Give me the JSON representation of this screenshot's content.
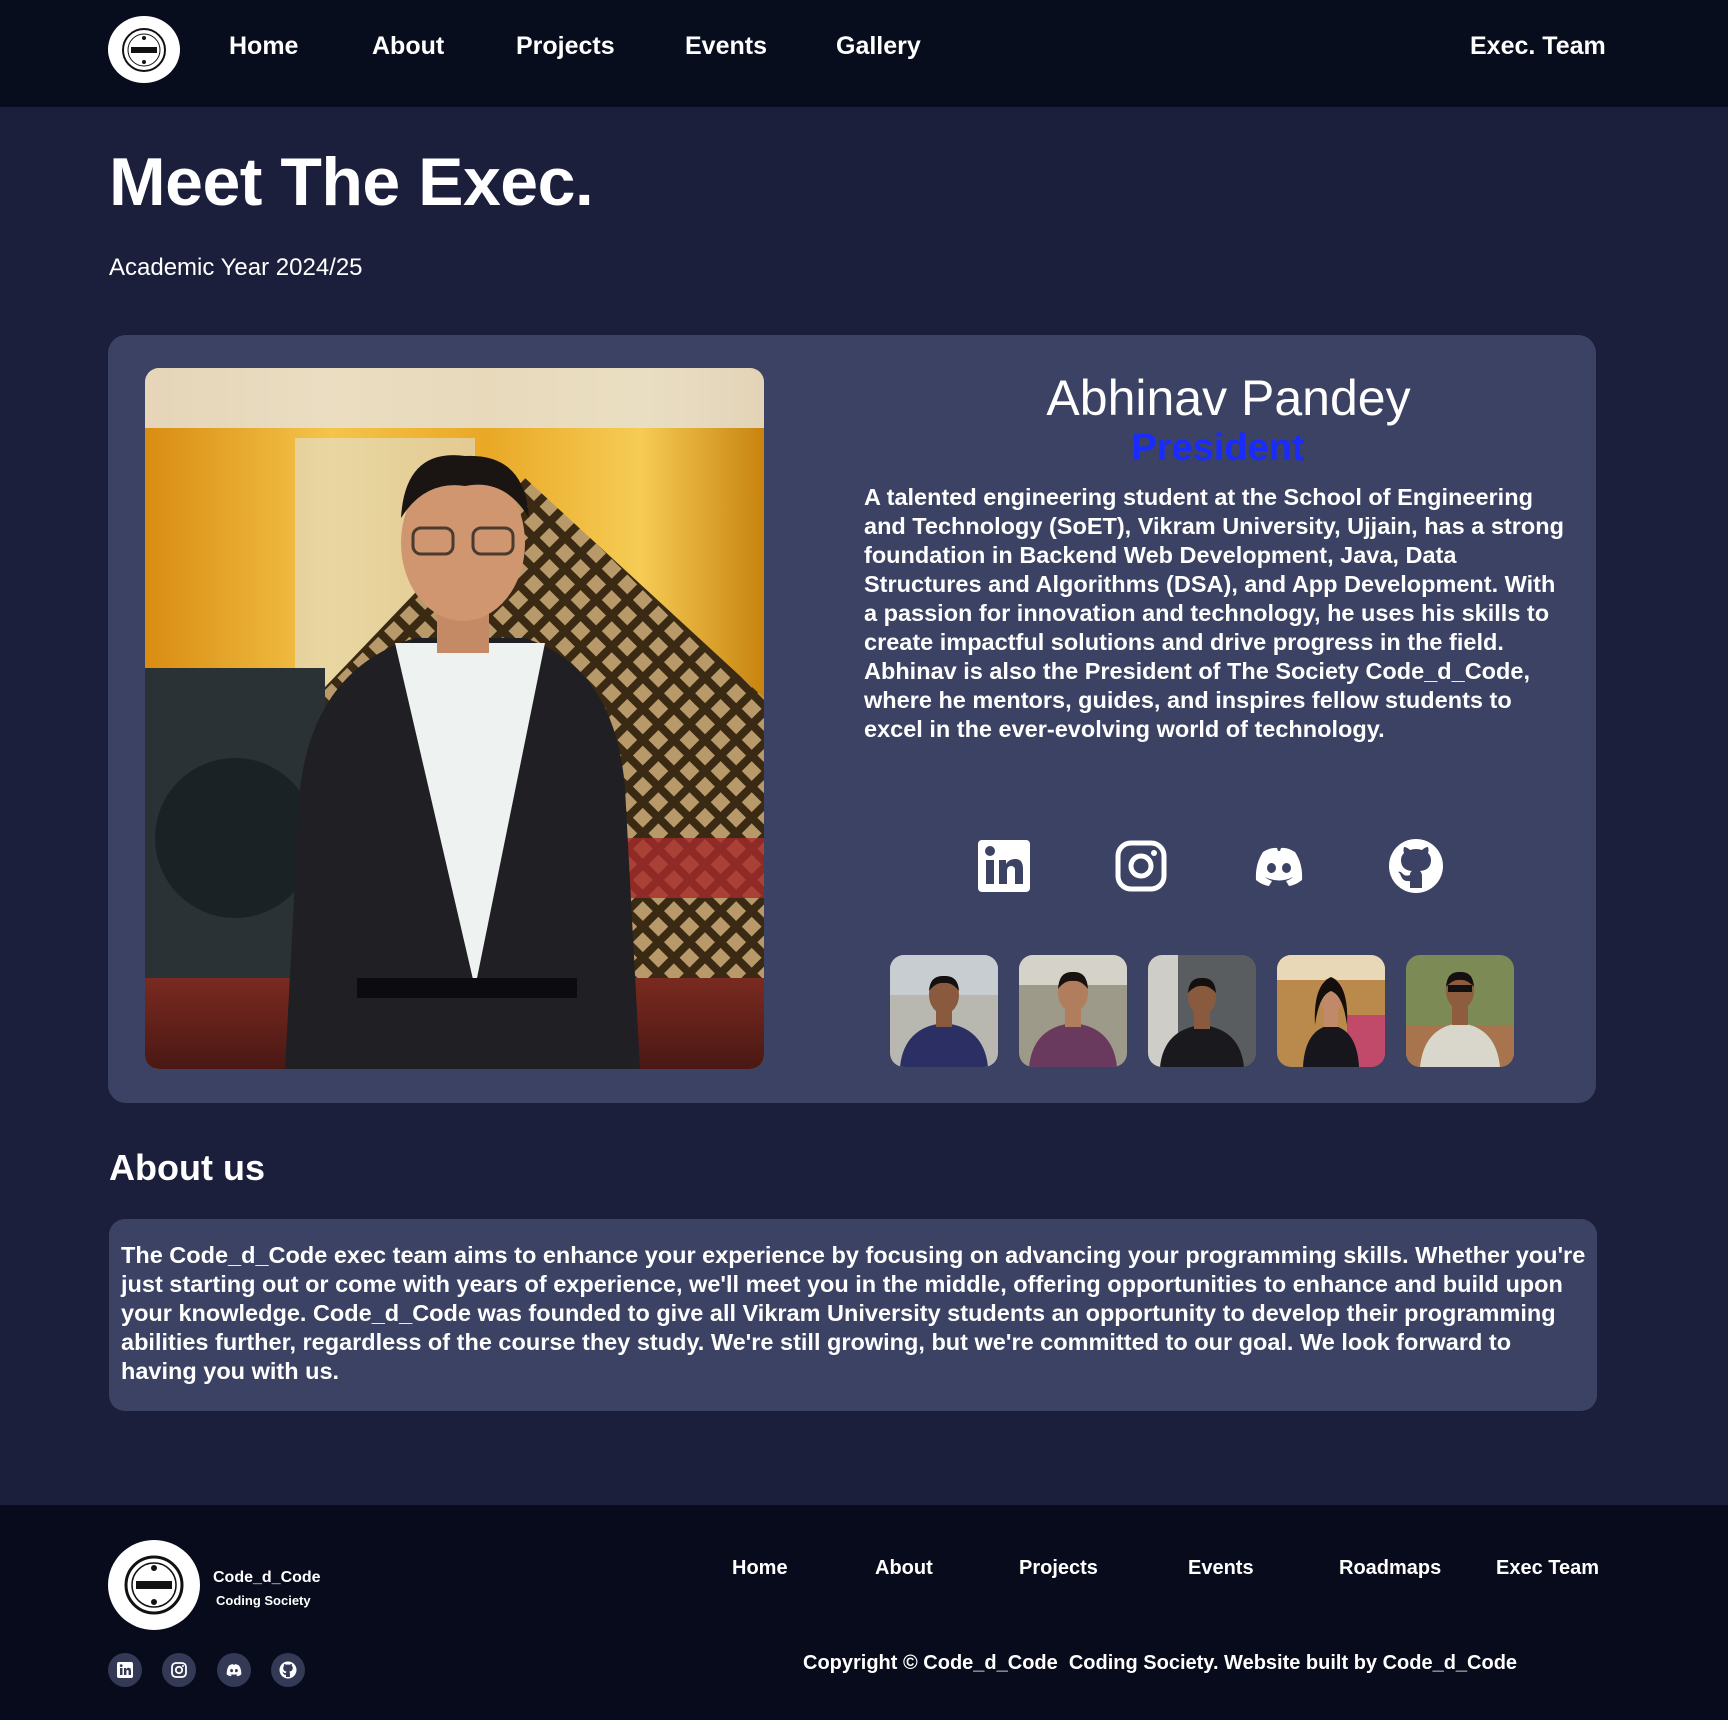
{
  "nav": {
    "logo_alt": "Code_d_Code logo",
    "links": [
      "Home",
      "About",
      "Projects",
      "Events",
      "Gallery"
    ],
    "exec_team": "Exec. Team"
  },
  "hero": {
    "title": "Meet The Exec.",
    "subtitle": "Academic Year 2024/25"
  },
  "featured_member": {
    "name": "Abhinav Pandey",
    "role": "President",
    "bio": "A talented engineering student at the School of Engineering and Technology (SoET), Vikram University, Ujjain, has a strong foundation in Backend Web Development, Java, Data Structures and Algorithms (DSA), and App Development. With a passion for innovation and technology, he uses his skills to create impactful solutions and drive progress in the field. Abhinav is also the President of The Society Code_d_Code, where he mentors, guides, and inspires fellow students to excel in the ever-evolving world of technology.",
    "socials": [
      "linkedin-icon",
      "instagram-icon",
      "discord-icon",
      "github-icon"
    ]
  },
  "team_thumbnails": [
    {
      "shirt": "#2b2f63",
      "bg": "#b8b8b0"
    },
    {
      "shirt": "#6a3a5e",
      "bg": "#9d9a8a"
    },
    {
      "shirt": "#1a1a1e",
      "bg": "#5a5d60"
    },
    {
      "shirt": "#16161c",
      "bg": "#b98a4c"
    },
    {
      "shirt": "#d9d6cc",
      "bg": "#7c8a55"
    }
  ],
  "about": {
    "heading": "About us",
    "text": "The Code_d_Code exec team aims to enhance your experience by focusing on advancing your programming skills. Whether you're just starting out or come with years of experience, we'll meet you in the middle, offering opportunities to enhance and build upon your knowledge. Code_d_Code was founded to give all Vikram University students an opportunity to develop their programming abilities further, regardless of the course they study. We're still growing, but we're committed to our goal. We look forward to having you with us."
  },
  "footer": {
    "brand": "Code_d_Code",
    "tagline": "Coding Society",
    "links": [
      "Home",
      "About",
      "Projects",
      "Events",
      "Roadmaps",
      "Exec Team"
    ],
    "copyright": "Copyright © Code_d_Code  Coding Society. Website built by Code_d_Code",
    "socials": [
      "linkedin-icon",
      "instagram-icon",
      "discord-icon",
      "github-icon"
    ]
  },
  "colors": {
    "page_bg": "#1b1f3b",
    "nav_bg": "#080d1e",
    "card_bg": "#3b4263",
    "role_accent": "#1a2bff",
    "footer_bg": "#070b1c"
  }
}
